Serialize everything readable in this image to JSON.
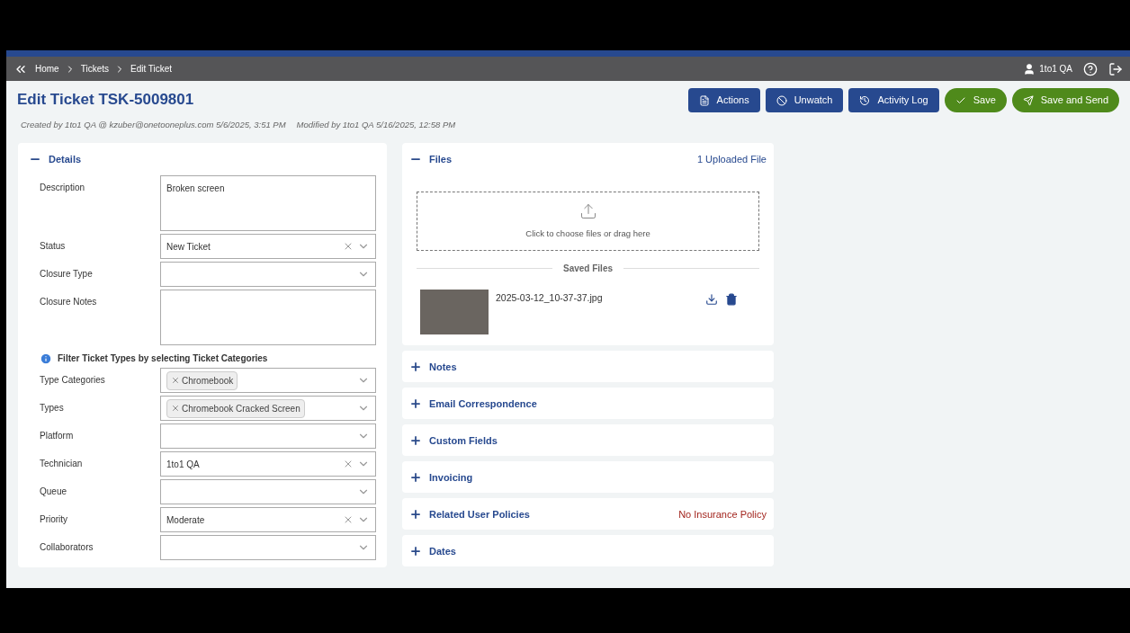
{
  "breadcrumb": [
    {
      "label": "Home"
    },
    {
      "label": "Tickets"
    },
    {
      "label": "Edit Ticket"
    }
  ],
  "user": {
    "name": "1to1 QA"
  },
  "page": {
    "title": "Edit Ticket TSK-5009801",
    "created": "Created by 1to1 QA @ kzuber@onetooneplus.com 5/6/2025, 3:51 PM",
    "modified": "Modified by 1to1 QA 5/16/2025, 12:58 PM"
  },
  "actions": [
    {
      "label": "Actions",
      "kind": "actions"
    },
    {
      "label": "Unwatch",
      "kind": "unwatch"
    },
    {
      "label": "Activity Log",
      "kind": "log"
    },
    {
      "label": "Save",
      "kind": "save"
    },
    {
      "label": "Save and Send",
      "kind": "send"
    }
  ],
  "details": {
    "title": "Details",
    "expanded": true,
    "fields": [
      {
        "label": "Description",
        "kind": "textarea",
        "value": "Broken screen"
      },
      {
        "label": "Status",
        "kind": "select",
        "value": "New Ticket",
        "clearable": true
      },
      {
        "label": "Closure Type",
        "kind": "select",
        "clearable": false
      },
      {
        "label": "Closure Notes",
        "kind": "textarea"
      },
      {
        "kind": "info",
        "label": "Filter Ticket Types by selecting Ticket Categories"
      },
      {
        "label": "Type Categories",
        "kind": "multiselect",
        "tags": [
          "Chromebook"
        ]
      },
      {
        "label": "Types",
        "kind": "multiselect",
        "tags": [
          "Chromebook Cracked Screen"
        ]
      },
      {
        "label": "Platform",
        "kind": "select",
        "clearable": false
      },
      {
        "label": "Technician",
        "kind": "select",
        "value": "1to1 QA",
        "clearable": true
      },
      {
        "label": "Queue",
        "kind": "select",
        "clearable": false
      },
      {
        "label": "Priority",
        "kind": "select",
        "value": "Moderate",
        "clearable": true
      },
      {
        "label": "Collaborators",
        "kind": "select",
        "clearable": false
      }
    ]
  },
  "files": {
    "title": "Files",
    "expanded": true,
    "count": "1 Uploaded File",
    "dropzone": "Click to choose files or drag here",
    "saved_heading": "Saved Files",
    "saved": [
      {
        "name": "2025-03-12_10-37-37.jpg"
      }
    ]
  },
  "sections": [
    {
      "title": "Notes",
      "expanded": false
    },
    {
      "title": "Email Correspondence",
      "expanded": false
    },
    {
      "title": "Custom Fields",
      "expanded": false
    },
    {
      "title": "Invoicing",
      "expanded": false
    },
    {
      "title": "Related User Policies",
      "expanded": false,
      "note": "No Insurance Policy"
    },
    {
      "title": "Dates",
      "expanded": false
    }
  ]
}
